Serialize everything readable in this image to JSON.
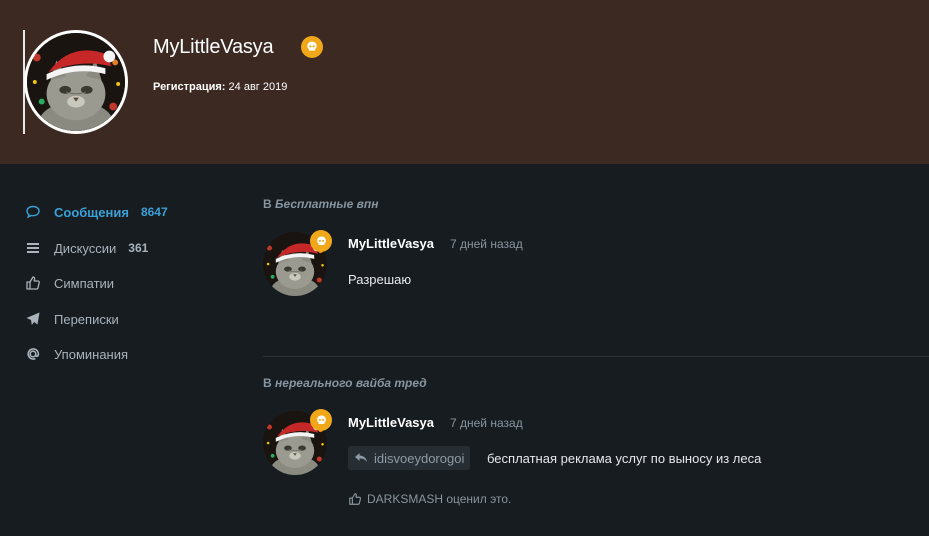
{
  "profile": {
    "username": "MyLittleVasya",
    "registration_label": "Регистрация:",
    "registration_date": "24 авг 2019"
  },
  "sidebar": {
    "items": [
      {
        "label": "Сообщения",
        "count": "8647",
        "icon": "message-icon",
        "active": true
      },
      {
        "label": "Дискуссии",
        "count": "361",
        "icon": "list-icon",
        "active": false
      },
      {
        "label": "Симпатии",
        "count": "",
        "icon": "thumbs-up-icon",
        "active": false
      },
      {
        "label": "Переписки",
        "count": "",
        "icon": "send-icon",
        "active": false
      },
      {
        "label": "Упоминания",
        "count": "",
        "icon": "at-icon",
        "active": false
      }
    ]
  },
  "posts": [
    {
      "section_prefix": "В",
      "section_title": "Бесплатные впн",
      "author": "MyLittleVasya",
      "time": "7 дней назад",
      "text": "Разрешаю"
    },
    {
      "section_prefix": "В",
      "section_title": "нереального вайба тред",
      "author": "MyLittleVasya",
      "time": "7 дней назад",
      "quote_user": "idisvoeydorogoi",
      "text": "бесплатная реклама услуг по выносу из леса",
      "reaction": "DARKSMASH оценил это."
    }
  ],
  "colors": {
    "header_bg": "#3c2a22",
    "page_bg": "#161c20",
    "accent": "#3aa0d8",
    "badge": "#f0a81a"
  }
}
